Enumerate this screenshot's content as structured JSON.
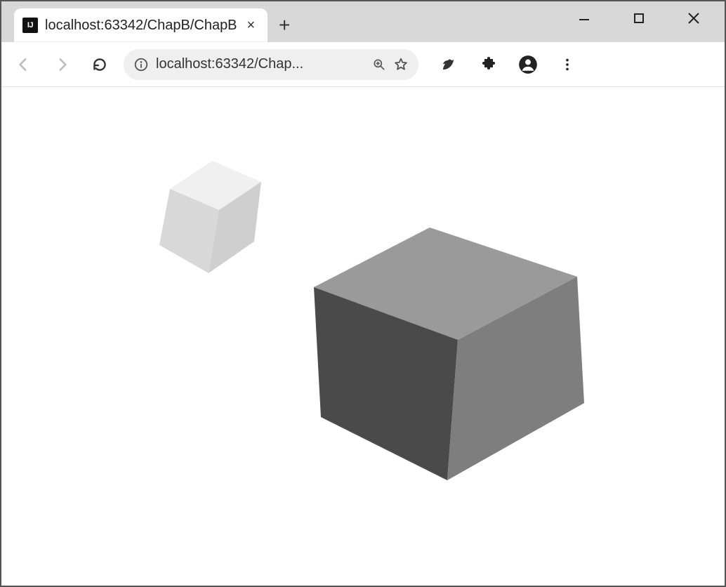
{
  "window": {
    "minimize_tooltip": "Minimize",
    "maximize_tooltip": "Maximize",
    "close_tooltip": "Close"
  },
  "tab": {
    "favicon_text": "IJ",
    "title": "localhost:63342/ChapB/ChapB",
    "close_tooltip": "Close tab",
    "new_tab_tooltip": "New tab"
  },
  "toolbar": {
    "back_tooltip": "Back",
    "forward_tooltip": "Forward",
    "reload_tooltip": "Reload"
  },
  "address": {
    "site_info_tooltip": "View site information",
    "url_display": "localhost:63342/Chap...",
    "zoom_tooltip": "Zoom",
    "bookmark_tooltip": "Bookmark this tab"
  },
  "actions": {
    "extension_tooltip": "Extension",
    "extensions_menu_tooltip": "Extensions",
    "profile_tooltip": "You",
    "menu_tooltip": "Customize and control"
  },
  "content": {
    "description": "3D canvas rendering two shaded cubes",
    "cubes": [
      {
        "name": "small-cube",
        "shade": "light"
      },
      {
        "name": "large-cube",
        "shade": "dark"
      }
    ]
  }
}
